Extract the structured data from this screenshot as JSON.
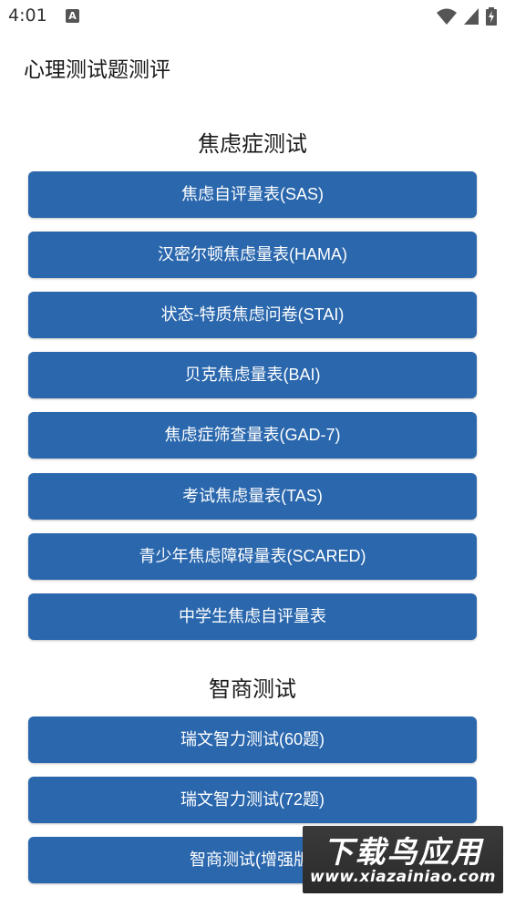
{
  "status_bar": {
    "time": "4:01",
    "notification_glyph": "A",
    "icons": [
      "wifi-icon",
      "cell-signal-icon",
      "battery-charging-icon"
    ]
  },
  "app": {
    "title": "心理测试题测评"
  },
  "sections": [
    {
      "title": "焦虑症测试",
      "items": [
        "焦虑自评量表(SAS)",
        "汉密尔顿焦虑量表(HAMA)",
        "状态-特质焦虑问卷(STAI)",
        "贝克焦虑量表(BAI)",
        "焦虑症筛查量表(GAD-7)",
        "考试焦虑量表(TAS)",
        "青少年焦虑障碍量表(SCARED)",
        "中学生焦虑自评量表"
      ]
    },
    {
      "title": "智商测试",
      "items": [
        "瑞文智力测试(60题)",
        "瑞文智力测试(72题)",
        "智商测试(增强版)"
      ]
    }
  ],
  "watermark": {
    "top": "下载鸟应用",
    "bottom": "www.xiazainiao.com"
  },
  "colors": {
    "button_bg": "#2a67ad",
    "button_text": "#ffffff",
    "background": "#ffffff"
  }
}
